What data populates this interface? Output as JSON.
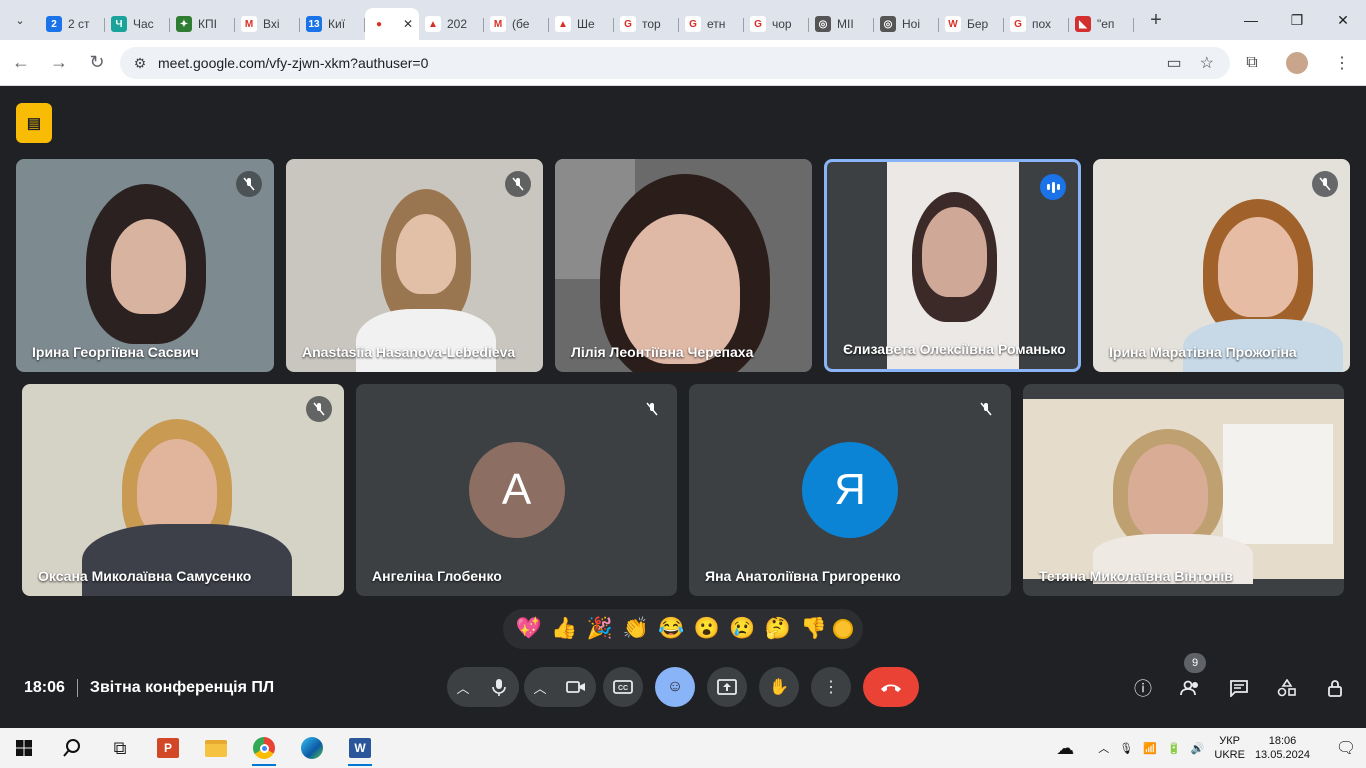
{
  "browser": {
    "tabs": [
      {
        "label": "2 ст",
        "fav_color": "#1a73e8",
        "fav_text": "2"
      },
      {
        "label": "Час",
        "fav_color": "#1aa39a",
        "fav_text": "Ч"
      },
      {
        "label": "КПІ",
        "fav_color": "#2e7d32",
        "fav_text": "✦"
      },
      {
        "label": "Вхі",
        "fav_color": "#ffffff",
        "fav_text": "M"
      },
      {
        "label": "Киї",
        "fav_color": "#1a73e8",
        "fav_text": "13"
      },
      {
        "label": "",
        "fav_color": "#ffffff",
        "fav_text": "●",
        "active": true
      },
      {
        "label": "202",
        "fav_color": "#ffffff",
        "fav_text": "▲"
      },
      {
        "label": "(бе",
        "fav_color": "#ffffff",
        "fav_text": "M"
      },
      {
        "label": "Ше",
        "fav_color": "#ffffff",
        "fav_text": "▲"
      },
      {
        "label": "тор",
        "fav_color": "#ffffff",
        "fav_text": "G"
      },
      {
        "label": "етн",
        "fav_color": "#ffffff",
        "fav_text": "G"
      },
      {
        "label": "чор",
        "fav_color": "#ffffff",
        "fav_text": "G"
      },
      {
        "label": "МІІ",
        "fav_color": "#555555",
        "fav_text": "◎"
      },
      {
        "label": "Ноі",
        "fav_color": "#555555",
        "fav_text": "◎"
      },
      {
        "label": "Бер",
        "fav_color": "#ffffff",
        "fav_text": "W"
      },
      {
        "label": "пох",
        "fav_color": "#ffffff",
        "fav_text": "G"
      },
      {
        "label": "\"еп",
        "fav_color": "#d32f2f",
        "fav_text": "◣"
      }
    ],
    "url": "meet.google.com/vfy-zjwn-xkm?authuser=0"
  },
  "participants": [
    {
      "name": "Ірина Георгіївна Сасвич",
      "muted": true
    },
    {
      "name": "Anastasiia Hasanova-Lebedieva",
      "muted": true
    },
    {
      "name": "Лілія Леонтіївна Черепаха",
      "muted": false
    },
    {
      "name": "Єлизавета Олексіївна Романько",
      "speaking": true
    },
    {
      "name": "Ірина Маратівна Прожогіна",
      "muted": true
    },
    {
      "name": "Оксана Миколаївна Самусенко",
      "muted": true
    },
    {
      "name": "Ангеліна Глобенко",
      "muted": true,
      "avatar_letter": "А",
      "avatar_color": "#8d6e63"
    },
    {
      "name": "Яна Анатоліївна Григоренко",
      "muted": true,
      "avatar_letter": "Я",
      "avatar_color": "#0b84d6"
    },
    {
      "name": "Тетяна Миколаївна Вінтонів",
      "muted": false
    }
  ],
  "reactions": [
    "💖",
    "👍",
    "🎉",
    "👏",
    "😂",
    "😮",
    "😢",
    "🤔",
    "👎"
  ],
  "meeting": {
    "time": "18:06",
    "title": "Звітна конференція ПЛ",
    "people_count": "9"
  },
  "colors": {
    "hangup": "#ea4335",
    "active_border": "#8ab4f8",
    "rec_badge": "#f9bc05"
  },
  "taskbar": {
    "lang_top": "УКР",
    "lang_bottom": "UKRE",
    "clock_time": "18:06",
    "clock_date": "13.05.2024"
  }
}
